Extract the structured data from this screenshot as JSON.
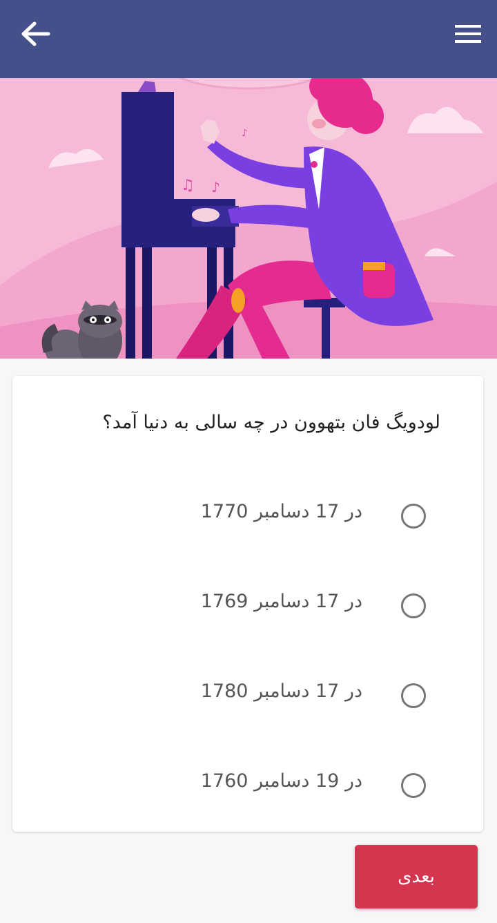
{
  "header": {
    "back_icon": "arrow-left-icon",
    "menu_icon": "hamburger-menu-icon",
    "background_color": "#45508b"
  },
  "hero": {
    "illustration": "pianist-illustration",
    "background_color": "#f6b9d8"
  },
  "quiz": {
    "question": "لودویگ فان بتهوون در چه سالی به دنیا آمد؟",
    "options": [
      {
        "label": "در 17 دسامبر 1770",
        "selected": false
      },
      {
        "label": "در 17 دسامبر 1769",
        "selected": false
      },
      {
        "label": "در 17 دسامبر 1780",
        "selected": false
      },
      {
        "label": "در 19 دسامبر 1760",
        "selected": false
      }
    ]
  },
  "footer": {
    "next_label": "بعدی",
    "next_color": "#d4354f"
  }
}
